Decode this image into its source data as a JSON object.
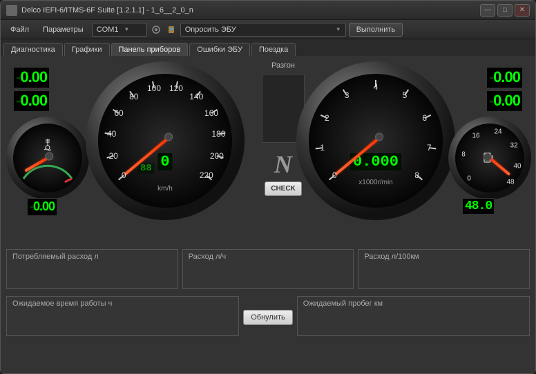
{
  "app": {
    "title": "Delco IEFI-6/ITMS-6F Suite [1.2.1.1] - 1_6__2_0_n"
  },
  "menu": {
    "file": "Файл",
    "params": "Параметры"
  },
  "toolbar": {
    "port": "COM1",
    "action": "Опросить ЭБУ",
    "execute": "Выполнить"
  },
  "tabs": [
    "Диагностика",
    "Графики",
    "Панель приборов",
    "Ошибки ЭБУ",
    "Поездка"
  ],
  "active_tab": 2,
  "digitals": {
    "top_left_1": "0.00",
    "top_left_2": "0.00",
    "top_right_1": "0.00",
    "top_right_2": "0.00",
    "temp": "0.00",
    "fuel": "48.0"
  },
  "speedo": {
    "unit": "km/h",
    "value": "0",
    "aux": "88",
    "max": 220,
    "ticks": [
      0,
      20,
      40,
      60,
      80,
      100,
      120,
      140,
      160,
      180,
      200,
      220
    ]
  },
  "tacho": {
    "unit": "x1000r/min",
    "value": "0.000",
    "max": 8,
    "ticks": [
      0,
      1,
      2,
      3,
      4,
      5,
      6,
      7,
      8
    ]
  },
  "center": {
    "accel": "Разгон",
    "gear": "N",
    "check": "CHECK"
  },
  "info": {
    "consumed": "Потребляемый расход л",
    "rate_hour": "Расход л/ч",
    "rate_100km": "Расход л/100км",
    "expected_time": "Ожидаемое время работы ч",
    "expected_dist": "Ожидаемый пробег км",
    "reset": "Обнулить"
  }
}
